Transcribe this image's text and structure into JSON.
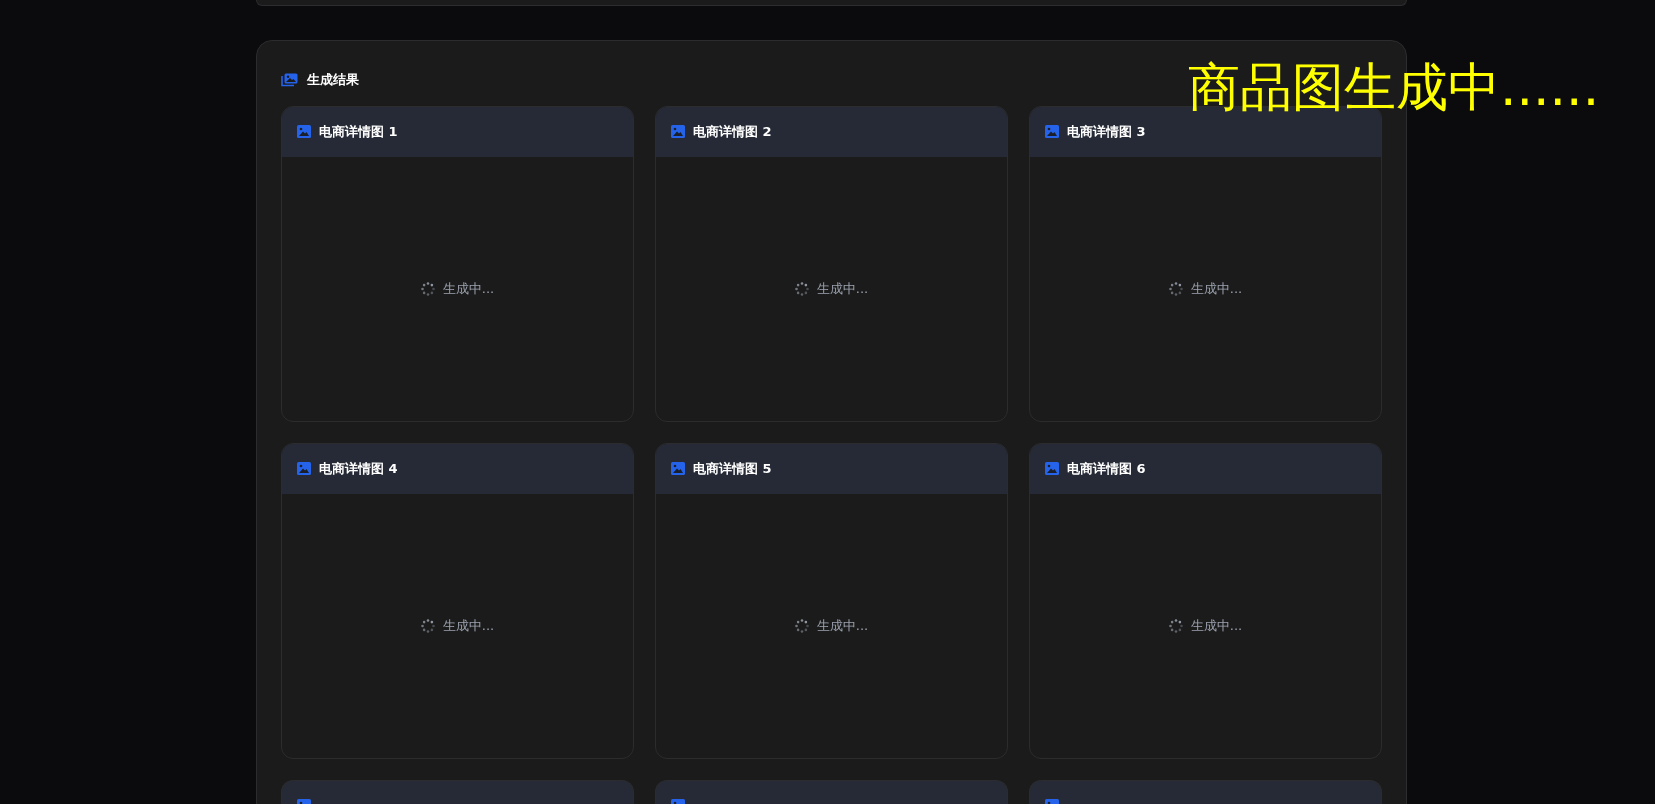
{
  "overlay_caption": "商品图生成中......",
  "results": {
    "title": "生成结果",
    "cards": [
      {
        "title": "电商详情图 1",
        "status": "生成中..."
      },
      {
        "title": "电商详情图 2",
        "status": "生成中..."
      },
      {
        "title": "电商详情图 3",
        "status": "生成中..."
      },
      {
        "title": "电商详情图 4",
        "status": "生成中..."
      },
      {
        "title": "电商详情图 5",
        "status": "生成中..."
      },
      {
        "title": "电商详情图 6",
        "status": "生成中..."
      },
      {
        "kind": "cut_off"
      },
      {
        "kind": "cut_off"
      },
      {
        "kind": "cut_off"
      }
    ]
  }
}
